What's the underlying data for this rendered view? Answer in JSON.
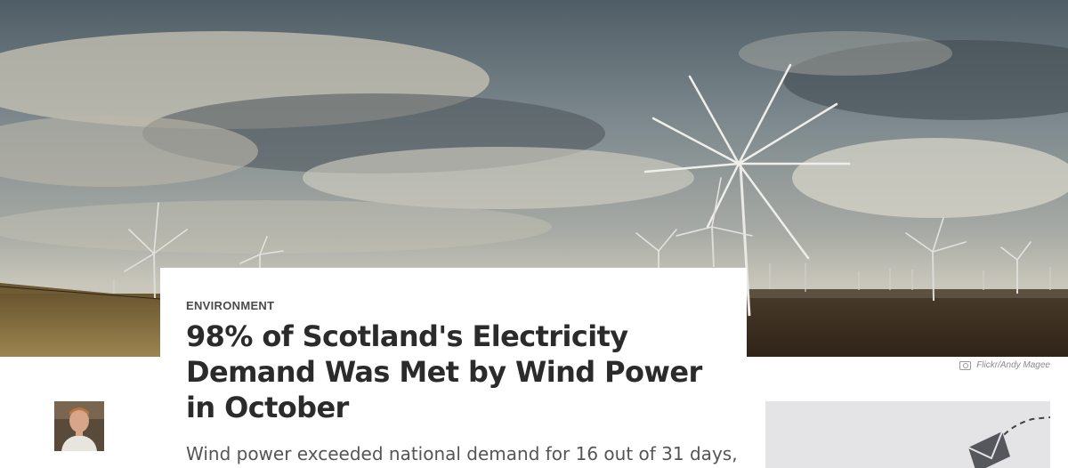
{
  "hero": {
    "image_icon": "wind-farm-photo",
    "photo_credit": "Flickr/Andy Magee"
  },
  "article": {
    "category": "ENVIRONMENT",
    "headline": "98% of Scotland's Electricity Demand Was Met by Wind Power in October",
    "subhead": "Wind power exceeded national demand for 16 out of 31 days,"
  },
  "author": {
    "avatar_icon": "author-avatar"
  },
  "sidebar": {
    "icon": "envelope-icon"
  }
}
